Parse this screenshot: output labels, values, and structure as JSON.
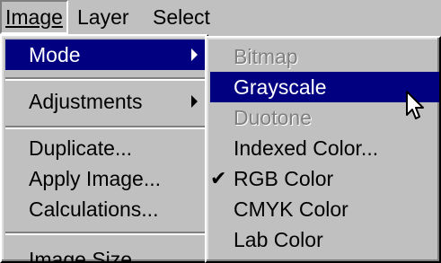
{
  "menubar": {
    "items": [
      {
        "label": "Image"
      },
      {
        "label": "Layer"
      },
      {
        "label": "Select"
      }
    ]
  },
  "image_menu": {
    "items": [
      {
        "label": "Mode",
        "submenu": true,
        "highlighted": true
      },
      {
        "label": "Adjustments",
        "submenu": true
      },
      {
        "label": "Duplicate..."
      },
      {
        "label": "Apply Image..."
      },
      {
        "label": "Calculations..."
      },
      {
        "label": "Image Size..."
      }
    ]
  },
  "mode_menu": {
    "items": [
      {
        "label": "Bitmap",
        "enabled": false
      },
      {
        "label": "Grayscale",
        "highlighted": true
      },
      {
        "label": "Duotone",
        "enabled": false
      },
      {
        "label": "Indexed Color..."
      },
      {
        "label": "RGB Color",
        "checked": true
      },
      {
        "label": "CMYK Color"
      },
      {
        "label": "Lab Color"
      }
    ],
    "check_glyph": "✔"
  },
  "colors": {
    "menu_bg": "#c0c0c0",
    "highlight": "#000080",
    "highlight_text": "#ffffff",
    "disabled_text": "#808080"
  },
  "icons": {
    "submenu_arrow": "triangle-right-icon",
    "check": "checkmark-icon",
    "pointer": "arrow-cursor-icon"
  }
}
